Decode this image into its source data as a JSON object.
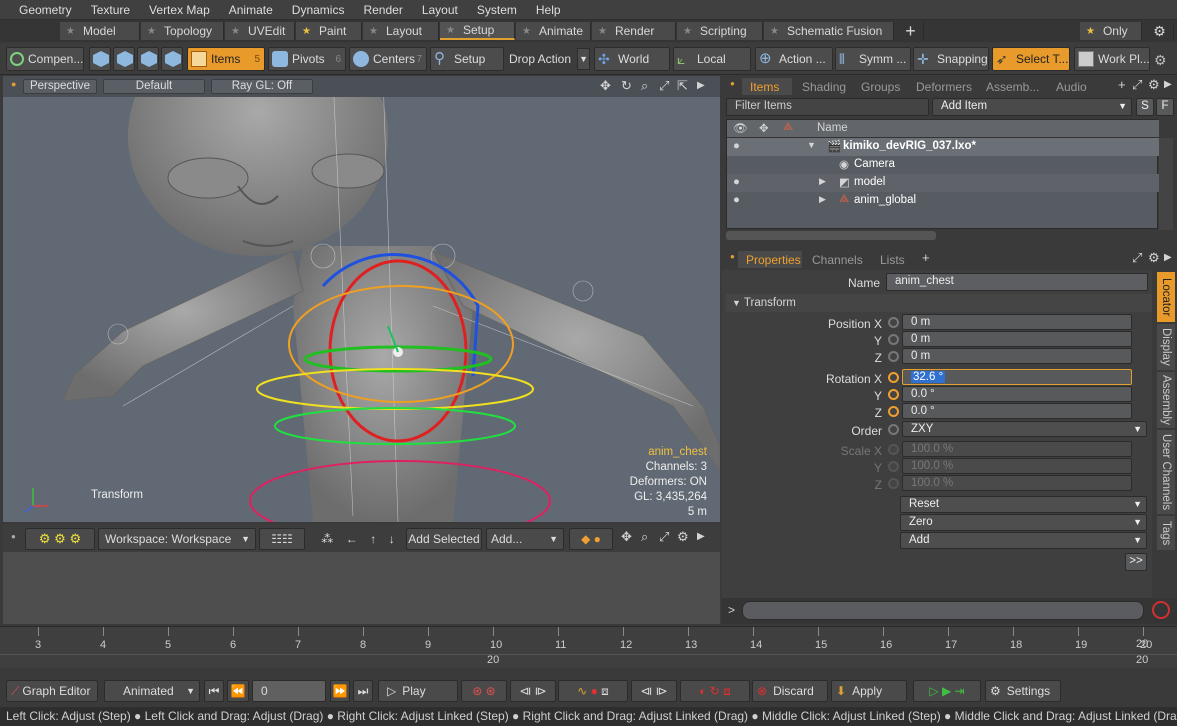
{
  "menu": [
    "Geometry",
    "Texture",
    "Vertex Map",
    "Animate",
    "Dynamics",
    "Render",
    "Layout",
    "System",
    "Help"
  ],
  "layout_tabs": [
    "Model",
    "Topology",
    "UVEdit",
    "Paint",
    "Layout",
    "Setup",
    "Animate",
    "Render",
    "Scripting",
    "Schematic Fusion"
  ],
  "layout_only": "Only",
  "toolbar": {
    "compen": "Compen...",
    "items": "Items",
    "items_num": "5",
    "pivots": "Pivots",
    "pivots_num": "6",
    "centers": "Centers",
    "centers_num": "7",
    "setup": "Setup",
    "drop_action": "Drop Action",
    "world": "World",
    "local": "Local",
    "action": "Action ...",
    "symm": "Symm ...",
    "snapping": "Snapping",
    "select_t": "Select T...",
    "work_pl": "Work Pl..."
  },
  "viewport": {
    "perspective": "Perspective",
    "default": "Default",
    "raygl": "Ray GL: Off",
    "transform_label": "Transform",
    "info_name": "anim_chest",
    "info_channels": "Channels: 3",
    "info_deformers": "Deformers: ON",
    "info_gl": "GL: 3,435,264",
    "info_scale": "5 m"
  },
  "lower": {
    "workspace": "Workspace: Workspace",
    "add_selected": "Add Selected",
    "add": "Add..."
  },
  "items_panel": {
    "tabs": [
      "Items",
      "Shading",
      "Groups",
      "Deformers",
      "Assemb...",
      "Audio"
    ],
    "filter": "Filter Items",
    "add_item": "Add Item",
    "s_btn": "S",
    "f_btn": "F",
    "col_name": "Name",
    "rows": [
      {
        "name": "kimiko_devRIG_037.lxo*"
      },
      {
        "name": "Camera"
      },
      {
        "name": "model"
      },
      {
        "name": "anim_global"
      }
    ]
  },
  "properties": {
    "tabs": [
      "Properties",
      "Channels",
      "Lists"
    ],
    "name_label": "Name",
    "name_value": "anim_chest",
    "section": "Transform",
    "position_label": "Position X",
    "y_label": "Y",
    "z_label": "Z",
    "pos_x": "0 m",
    "pos_y": "0 m",
    "pos_z": "0 m",
    "rotation_label": "Rotation X",
    "rot_x": "32.6 °",
    "rot_y": "0.0 °",
    "rot_z": "0.0 °",
    "order_label": "Order",
    "order_value": "ZXY",
    "scale_label": "Scale X",
    "scale_x": "100.0 %",
    "scale_y": "100.0 %",
    "scale_z": "100.0 %",
    "reset": "Reset",
    "zero": "Zero",
    "add": "Add",
    "more": ">>",
    "side_tabs": [
      "Locator",
      "Display",
      "Assembly",
      "User Channels",
      "Tags"
    ]
  },
  "cmd_prompt": ">",
  "timeline": {
    "ticks": [
      "3",
      "4",
      "5",
      "6",
      "7",
      "8",
      "9",
      "10",
      "11",
      "12",
      "13",
      "14",
      "15",
      "16",
      "17",
      "18",
      "19",
      "20"
    ],
    "end_a": "20",
    "end_b": "20"
  },
  "transport": {
    "graph_editor": "Graph Editor",
    "animated": "Animated",
    "frame": "0",
    "play": "Play",
    "discard": "Discard",
    "apply": "Apply",
    "settings": "Settings"
  },
  "status": "Left Click: Adjust (Step) ● Left Click and Drag: Adjust (Drag) ● Right Click: Adjust Linked (Step) ● Right Click and Drag: Adjust Linked (Drag) ● Middle Click: Adjust Linked (Step) ● Middle Click and Drag: Adjust Linked (Drag)"
}
